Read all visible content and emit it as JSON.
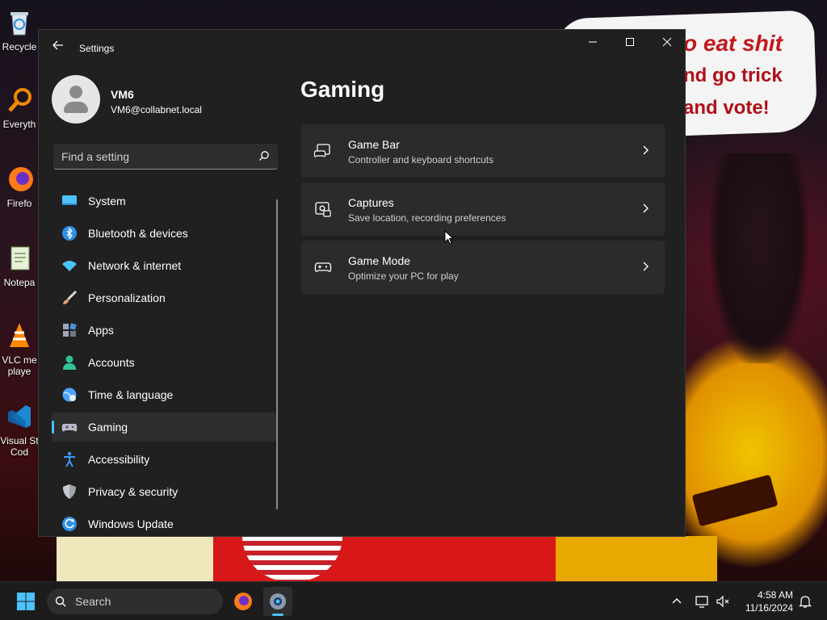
{
  "desktop": {
    "wallpaper_text": [
      "o eat shit",
      "nd go trick",
      "and vote!"
    ],
    "icons": [
      {
        "label": "Recycle",
        "icon": "recycle-bin-icon"
      },
      {
        "label": "Everyth",
        "icon": "everything-search-icon"
      },
      {
        "label": "Firefo",
        "icon": "firefox-icon"
      },
      {
        "label": "Notepa",
        "icon": "notepad-icon"
      },
      {
        "label": "VLC me",
        "label2": "playe",
        "icon": "vlc-icon"
      },
      {
        "label": "Visual St",
        "label2": "Cod",
        "icon": "vscode-icon"
      }
    ]
  },
  "window": {
    "title": "Settings",
    "controls": {
      "minimize": "—",
      "maximize": "☐",
      "close": "✕"
    }
  },
  "user": {
    "name": "VM6",
    "email": "VM6@collabnet.local"
  },
  "search": {
    "placeholder": "Find a setting"
  },
  "nav": {
    "active": "Gaming",
    "items": [
      {
        "label": "System",
        "icon": "system-display-icon",
        "color": "#4cc2ff"
      },
      {
        "label": "Bluetooth & devices",
        "icon": "bluetooth-icon",
        "color": "#2f8fe6"
      },
      {
        "label": "Network & internet",
        "icon": "wifi-icon",
        "color": "#4cc2ff"
      },
      {
        "label": "Personalization",
        "icon": "paintbrush-icon",
        "color": "#e8a070"
      },
      {
        "label": "Apps",
        "icon": "apps-icon",
        "color": "#9aa7b8"
      },
      {
        "label": "Accounts",
        "icon": "accounts-icon",
        "color": "#2fc39a"
      },
      {
        "label": "Time & language",
        "icon": "globe-clock-icon",
        "color": "#4ca3ff"
      },
      {
        "label": "Gaming",
        "icon": "gamepad-icon",
        "color": "#b8b8c8"
      },
      {
        "label": "Accessibility",
        "icon": "accessibility-icon",
        "color": "#3a9bff"
      },
      {
        "label": "Privacy & security",
        "icon": "shield-icon",
        "color": "#a0a4ad"
      },
      {
        "label": "Windows Update",
        "icon": "windows-update-icon",
        "color": "#2f8fe6"
      }
    ]
  },
  "page": {
    "title": "Gaming",
    "cards": [
      {
        "title": "Game Bar",
        "desc": "Controller and keyboard shortcuts",
        "icon": "game-bar-icon"
      },
      {
        "title": "Captures",
        "desc": "Save location, recording preferences",
        "icon": "captures-icon"
      },
      {
        "title": "Game Mode",
        "desc": "Optimize your PC for play",
        "icon": "game-mode-icon"
      }
    ]
  },
  "taskbar": {
    "search_label": "Search",
    "apps": [
      "firefox-icon",
      "settings-gear-icon"
    ],
    "clock": {
      "time": "4:58 AM",
      "date": "11/16/2024"
    }
  },
  "colors": {
    "accent": "#4cc2ff",
    "window_bg": "#202020",
    "card_bg": "#2b2b2b"
  }
}
